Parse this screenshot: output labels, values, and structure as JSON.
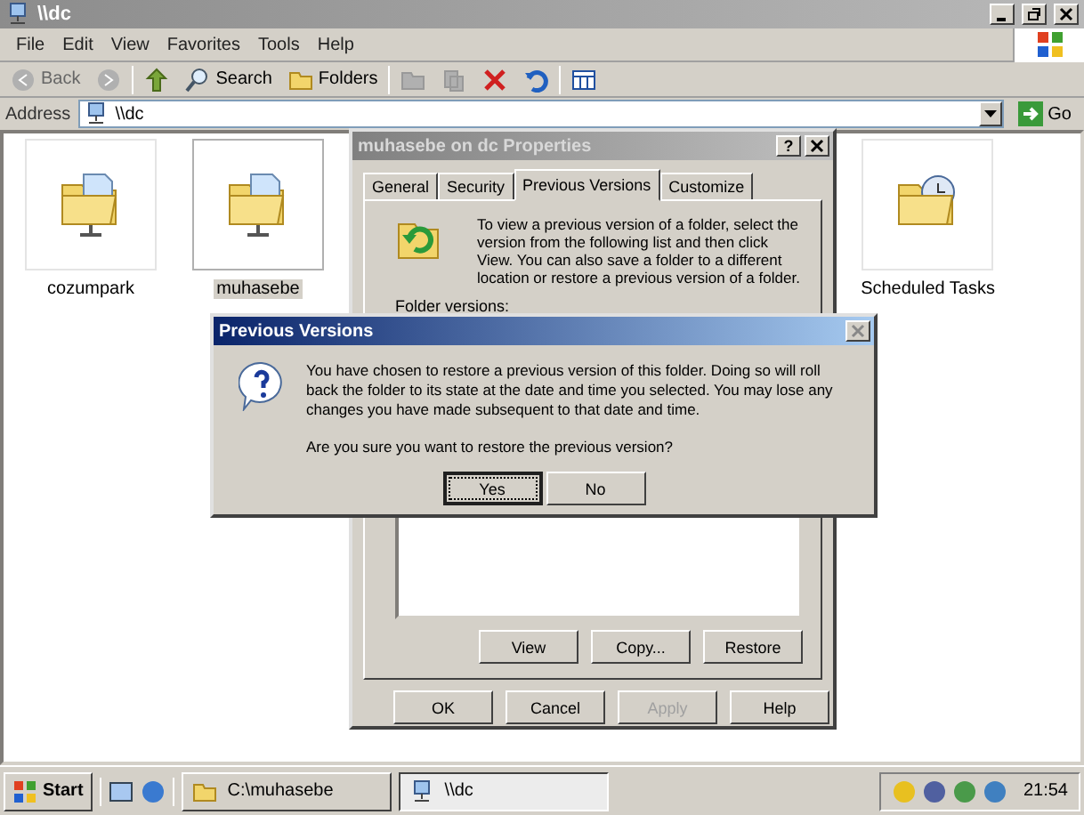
{
  "window": {
    "title": "\\\\dc"
  },
  "menu": [
    "File",
    "Edit",
    "View",
    "Favorites",
    "Tools",
    "Help"
  ],
  "toolbar": [
    {
      "kind": "back",
      "label": "Back",
      "disabled": true
    },
    {
      "kind": "forward",
      "disabled": true
    },
    {
      "kind": "up",
      "disabled": false
    },
    {
      "kind": "search",
      "label": "Search",
      "disabled": false
    },
    {
      "kind": "folders",
      "label": "Folders",
      "disabled": false
    },
    {
      "kind": "move",
      "disabled": true
    },
    {
      "kind": "copy",
      "disabled": true
    },
    {
      "kind": "delete",
      "disabled": false
    },
    {
      "kind": "undo",
      "disabled": false
    },
    {
      "kind": "views",
      "disabled": false
    }
  ],
  "address": {
    "label": "Address",
    "value": "\\\\dc",
    "go": "Go"
  },
  "items": [
    {
      "label": "cozumpark",
      "kind": "share",
      "selected": false
    },
    {
      "label": "muhasebe",
      "kind": "share",
      "selected": true
    },
    {
      "label": "Scheduled Tasks",
      "kind": "tasks",
      "selected": false
    }
  ],
  "properties": {
    "title": "muhasebe on dc Properties",
    "help_button": "?",
    "tabs": [
      {
        "label": "General",
        "selected": false
      },
      {
        "label": "Security",
        "selected": false
      },
      {
        "label": "Previous Versions",
        "selected": true
      },
      {
        "label": "Customize",
        "selected": false
      }
    ],
    "description": "To view a previous version of a folder, select the version from the following list and then click View.  You can also save a folder to a different location or restore a previous version of a folder.",
    "list_label": "Folder versions:",
    "actions": [
      {
        "label": "View",
        "disabled": false
      },
      {
        "label": "Copy...",
        "disabled": false
      },
      {
        "label": "Restore",
        "disabled": false
      }
    ],
    "buttons": [
      {
        "label": "OK",
        "disabled": false
      },
      {
        "label": "Cancel",
        "disabled": false
      },
      {
        "label": "Apply",
        "disabled": true
      },
      {
        "label": "Help",
        "disabled": false
      }
    ]
  },
  "message": {
    "title": "Previous Versions",
    "text": "You have chosen to restore a previous version of this folder. Doing so will roll back the folder to its state at the date and time you selected. You may lose any changes you have made subsequent to that date and time.",
    "question": "Are you sure you want to restore the previous version?",
    "buttons": [
      {
        "label": "Yes",
        "selected": true
      },
      {
        "label": "No",
        "selected": false
      }
    ]
  },
  "taskbar": {
    "start": "Start",
    "tasks": [
      {
        "label": "C:\\muhasebe",
        "selected": false
      },
      {
        "label": "\\\\dc",
        "selected": true
      }
    ],
    "clock": "21:54"
  }
}
